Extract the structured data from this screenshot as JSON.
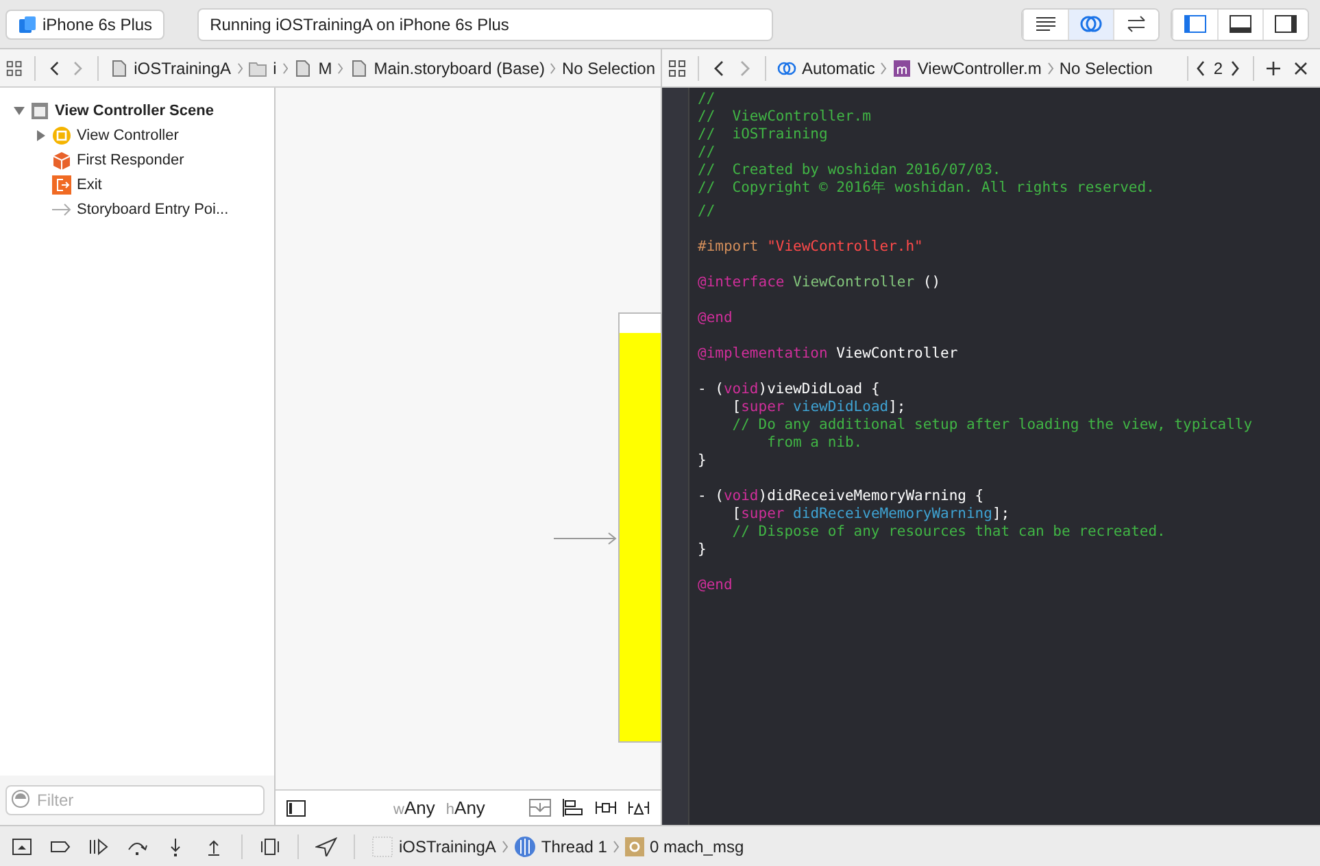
{
  "toolbar": {
    "scheme_target": "iPhone 6s Plus",
    "activity": "Running iOSTrainingA on iPhone 6s Plus",
    "editor_modes": [
      {
        "kind": "standard",
        "selected": false
      },
      {
        "kind": "assistant",
        "selected": true
      },
      {
        "kind": "version",
        "selected": false
      }
    ],
    "panels": [
      {
        "kind": "navigator",
        "selected": true
      },
      {
        "kind": "debug",
        "selected": false
      },
      {
        "kind": "utilities",
        "selected": false
      }
    ]
  },
  "left_jump_bar": [
    {
      "kind": "doc",
      "text": "iOSTrainingA"
    },
    {
      "kind": "folder",
      "text": "i"
    },
    {
      "kind": "doc",
      "text": "M"
    },
    {
      "kind": "doc",
      "text": "Main.storyboard (Base)"
    },
    {
      "kind": "none",
      "text": "No Selection"
    }
  ],
  "right_jump_bar": [
    {
      "kind": "assistant",
      "text": "Automatic"
    },
    {
      "kind": "m",
      "text": "ViewController.m"
    },
    {
      "kind": "none",
      "text": "No Selection"
    }
  ],
  "right_counter": "2",
  "outline": {
    "label": "View Controller Scene",
    "expanded": true,
    "children": [
      {
        "kind": "vc",
        "label": "View Controller",
        "expanded": false
      },
      {
        "kind": "responder",
        "label": "First Responder"
      },
      {
        "kind": "exit",
        "label": "Exit"
      },
      {
        "kind": "entry",
        "label": "Storyboard Entry Poi..."
      }
    ]
  },
  "filter": {
    "placeholder": "Filter"
  },
  "size_class": {
    "w_prefix": "w",
    "w_value": "Any",
    "h_prefix": "h",
    "h_value": "Any"
  },
  "code": [
    {
      "kind": "code",
      "tokens": [
        {
          "kind": "comment",
          "text": "//"
        }
      ]
    },
    {
      "kind": "code",
      "tokens": [
        {
          "kind": "comment",
          "text": "//  ViewController.m"
        }
      ]
    },
    {
      "kind": "code",
      "tokens": [
        {
          "kind": "comment",
          "text": "//  iOSTraining"
        }
      ]
    },
    {
      "kind": "code",
      "tokens": [
        {
          "kind": "comment",
          "text": "//"
        }
      ]
    },
    {
      "kind": "code",
      "tokens": [
        {
          "kind": "comment",
          "text": "//  Created by woshidan 2016/07/03."
        }
      ]
    },
    {
      "kind": "code",
      "tokens": [
        {
          "kind": "comment",
          "text": "//  Copyright © 2016年 woshidan. All rights reserved."
        }
      ]
    },
    {
      "kind": "code",
      "tokens": [
        {
          "kind": "comment",
          "text": "//"
        }
      ]
    },
    {
      "kind": "blank"
    },
    {
      "kind": "code",
      "tokens": [
        {
          "kind": "directive",
          "text": "#import "
        },
        {
          "kind": "string",
          "text": "\"ViewController.h\""
        }
      ]
    },
    {
      "kind": "blank"
    },
    {
      "kind": "code",
      "tokens": [
        {
          "kind": "keyword",
          "text": "@interface "
        },
        {
          "kind": "class",
          "text": "ViewController"
        },
        {
          "kind": "plain",
          "text": " ()"
        }
      ]
    },
    {
      "kind": "blank"
    },
    {
      "kind": "code",
      "tokens": [
        {
          "kind": "keyword",
          "text": "@end"
        }
      ]
    },
    {
      "kind": "blank"
    },
    {
      "kind": "code",
      "tokens": [
        {
          "kind": "keyword",
          "text": "@implementation"
        },
        {
          "kind": "plain",
          "text": " ViewController"
        }
      ]
    },
    {
      "kind": "blank"
    },
    {
      "kind": "code",
      "tokens": [
        {
          "kind": "plain",
          "text": "- ("
        },
        {
          "kind": "keyword",
          "text": "void"
        },
        {
          "kind": "plain",
          "text": ")viewDidLoad {"
        }
      ]
    },
    {
      "kind": "code",
      "tokens": [
        {
          "kind": "plain",
          "text": "    ["
        },
        {
          "kind": "keyword",
          "text": "super "
        },
        {
          "kind": "method",
          "text": "viewDidLoad"
        },
        {
          "kind": "plain",
          "text": "];"
        }
      ]
    },
    {
      "kind": "code",
      "tokens": [
        {
          "kind": "comment",
          "text": "    // Do any additional setup after loading the view, typically"
        }
      ]
    },
    {
      "kind": "code",
      "tokens": [
        {
          "kind": "comment",
          "text": "        from a nib."
        }
      ]
    },
    {
      "kind": "code",
      "tokens": [
        {
          "kind": "plain",
          "text": "}"
        }
      ]
    },
    {
      "kind": "blank"
    },
    {
      "kind": "code",
      "tokens": [
        {
          "kind": "plain",
          "text": "- ("
        },
        {
          "kind": "keyword",
          "text": "void"
        },
        {
          "kind": "plain",
          "text": ")didReceiveMemoryWarning {"
        }
      ]
    },
    {
      "kind": "code",
      "tokens": [
        {
          "kind": "plain",
          "text": "    ["
        },
        {
          "kind": "keyword",
          "text": "super "
        },
        {
          "kind": "method",
          "text": "didReceiveMemoryWarning"
        },
        {
          "kind": "plain",
          "text": "];"
        }
      ]
    },
    {
      "kind": "code",
      "tokens": [
        {
          "kind": "comment",
          "text": "    // Dispose of any resources that can be recreated."
        }
      ]
    },
    {
      "kind": "code",
      "tokens": [
        {
          "kind": "plain",
          "text": "}"
        }
      ]
    },
    {
      "kind": "blank"
    },
    {
      "kind": "code",
      "tokens": [
        {
          "kind": "keyword",
          "text": "@end"
        }
      ]
    }
  ],
  "debug_bar": {
    "process": "iOSTrainingA",
    "thread": "Thread 1",
    "frame": "0 mach_msg"
  }
}
